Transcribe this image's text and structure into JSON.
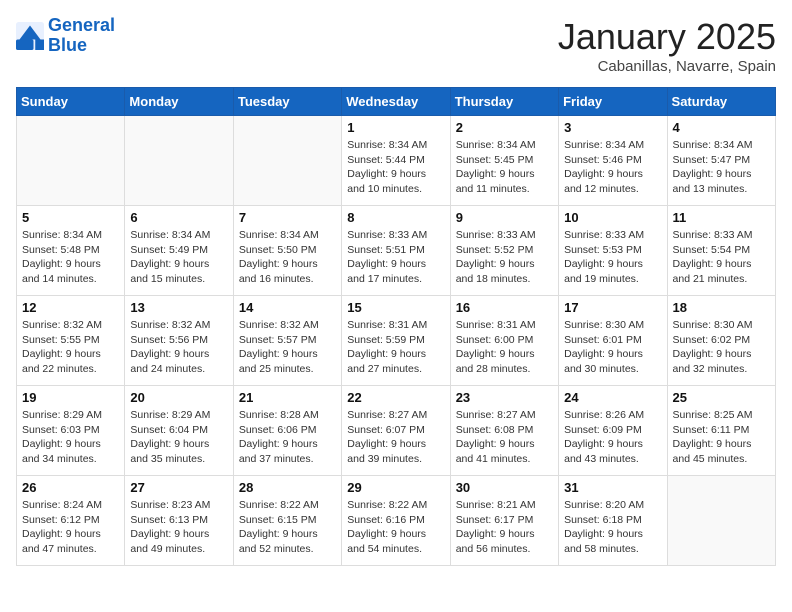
{
  "logo": {
    "line1": "General",
    "line2": "Blue"
  },
  "title": "January 2025",
  "subtitle": "Cabanillas, Navarre, Spain",
  "weekdays": [
    "Sunday",
    "Monday",
    "Tuesday",
    "Wednesday",
    "Thursday",
    "Friday",
    "Saturday"
  ],
  "weeks": [
    [
      {
        "day": "",
        "info": ""
      },
      {
        "day": "",
        "info": ""
      },
      {
        "day": "",
        "info": ""
      },
      {
        "day": "1",
        "info": "Sunrise: 8:34 AM\nSunset: 5:44 PM\nDaylight: 9 hours\nand 10 minutes."
      },
      {
        "day": "2",
        "info": "Sunrise: 8:34 AM\nSunset: 5:45 PM\nDaylight: 9 hours\nand 11 minutes."
      },
      {
        "day": "3",
        "info": "Sunrise: 8:34 AM\nSunset: 5:46 PM\nDaylight: 9 hours\nand 12 minutes."
      },
      {
        "day": "4",
        "info": "Sunrise: 8:34 AM\nSunset: 5:47 PM\nDaylight: 9 hours\nand 13 minutes."
      }
    ],
    [
      {
        "day": "5",
        "info": "Sunrise: 8:34 AM\nSunset: 5:48 PM\nDaylight: 9 hours\nand 14 minutes."
      },
      {
        "day": "6",
        "info": "Sunrise: 8:34 AM\nSunset: 5:49 PM\nDaylight: 9 hours\nand 15 minutes."
      },
      {
        "day": "7",
        "info": "Sunrise: 8:34 AM\nSunset: 5:50 PM\nDaylight: 9 hours\nand 16 minutes."
      },
      {
        "day": "8",
        "info": "Sunrise: 8:33 AM\nSunset: 5:51 PM\nDaylight: 9 hours\nand 17 minutes."
      },
      {
        "day": "9",
        "info": "Sunrise: 8:33 AM\nSunset: 5:52 PM\nDaylight: 9 hours\nand 18 minutes."
      },
      {
        "day": "10",
        "info": "Sunrise: 8:33 AM\nSunset: 5:53 PM\nDaylight: 9 hours\nand 19 minutes."
      },
      {
        "day": "11",
        "info": "Sunrise: 8:33 AM\nSunset: 5:54 PM\nDaylight: 9 hours\nand 21 minutes."
      }
    ],
    [
      {
        "day": "12",
        "info": "Sunrise: 8:32 AM\nSunset: 5:55 PM\nDaylight: 9 hours\nand 22 minutes."
      },
      {
        "day": "13",
        "info": "Sunrise: 8:32 AM\nSunset: 5:56 PM\nDaylight: 9 hours\nand 24 minutes."
      },
      {
        "day": "14",
        "info": "Sunrise: 8:32 AM\nSunset: 5:57 PM\nDaylight: 9 hours\nand 25 minutes."
      },
      {
        "day": "15",
        "info": "Sunrise: 8:31 AM\nSunset: 5:59 PM\nDaylight: 9 hours\nand 27 minutes."
      },
      {
        "day": "16",
        "info": "Sunrise: 8:31 AM\nSunset: 6:00 PM\nDaylight: 9 hours\nand 28 minutes."
      },
      {
        "day": "17",
        "info": "Sunrise: 8:30 AM\nSunset: 6:01 PM\nDaylight: 9 hours\nand 30 minutes."
      },
      {
        "day": "18",
        "info": "Sunrise: 8:30 AM\nSunset: 6:02 PM\nDaylight: 9 hours\nand 32 minutes."
      }
    ],
    [
      {
        "day": "19",
        "info": "Sunrise: 8:29 AM\nSunset: 6:03 PM\nDaylight: 9 hours\nand 34 minutes."
      },
      {
        "day": "20",
        "info": "Sunrise: 8:29 AM\nSunset: 6:04 PM\nDaylight: 9 hours\nand 35 minutes."
      },
      {
        "day": "21",
        "info": "Sunrise: 8:28 AM\nSunset: 6:06 PM\nDaylight: 9 hours\nand 37 minutes."
      },
      {
        "day": "22",
        "info": "Sunrise: 8:27 AM\nSunset: 6:07 PM\nDaylight: 9 hours\nand 39 minutes."
      },
      {
        "day": "23",
        "info": "Sunrise: 8:27 AM\nSunset: 6:08 PM\nDaylight: 9 hours\nand 41 minutes."
      },
      {
        "day": "24",
        "info": "Sunrise: 8:26 AM\nSunset: 6:09 PM\nDaylight: 9 hours\nand 43 minutes."
      },
      {
        "day": "25",
        "info": "Sunrise: 8:25 AM\nSunset: 6:11 PM\nDaylight: 9 hours\nand 45 minutes."
      }
    ],
    [
      {
        "day": "26",
        "info": "Sunrise: 8:24 AM\nSunset: 6:12 PM\nDaylight: 9 hours\nand 47 minutes."
      },
      {
        "day": "27",
        "info": "Sunrise: 8:23 AM\nSunset: 6:13 PM\nDaylight: 9 hours\nand 49 minutes."
      },
      {
        "day": "28",
        "info": "Sunrise: 8:22 AM\nSunset: 6:15 PM\nDaylight: 9 hours\nand 52 minutes."
      },
      {
        "day": "29",
        "info": "Sunrise: 8:22 AM\nSunset: 6:16 PM\nDaylight: 9 hours\nand 54 minutes."
      },
      {
        "day": "30",
        "info": "Sunrise: 8:21 AM\nSunset: 6:17 PM\nDaylight: 9 hours\nand 56 minutes."
      },
      {
        "day": "31",
        "info": "Sunrise: 8:20 AM\nSunset: 6:18 PM\nDaylight: 9 hours\nand 58 minutes."
      },
      {
        "day": "",
        "info": ""
      }
    ]
  ]
}
